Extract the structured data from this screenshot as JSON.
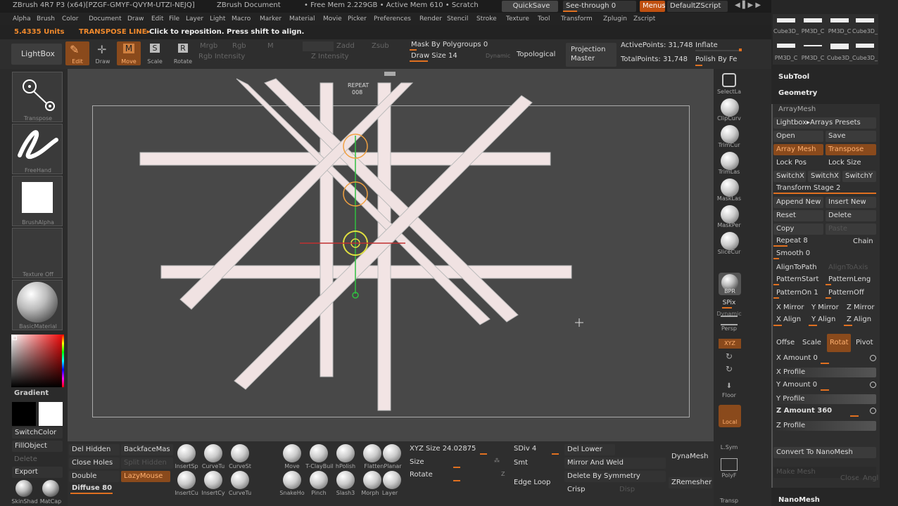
{
  "header": {
    "title": "ZBrush 4R7 P3 (x64)[PZGF-GMYF-QVYM-UTZI-NEJQ]",
    "doc": "ZBrush Document",
    "mem": "• Free Mem 2.229GB • Active Mem 610 • Scratch",
    "quicksave": "QuickSave",
    "seethrough": "See-through  0",
    "menus": "Menus",
    "script": "DefaultZScript"
  },
  "menu": [
    "Alpha",
    "Brush",
    "Color",
    "Document",
    "Draw",
    "Edit",
    "File",
    "Layer",
    "Light",
    "Macro",
    "Marker",
    "Material",
    "Movie",
    "Picker",
    "Preferences",
    "Render",
    "Stencil",
    "Stroke",
    "Texture",
    "Tool",
    "Transform",
    "Zplugin",
    "Zscript"
  ],
  "note": {
    "units": "5.4335 Units",
    "mode": "TRANSPOSE LINE▸",
    "msg": "Click to reposition. Press shift to align."
  },
  "shelf": {
    "lightbox": "LightBox",
    "edit": "Edit",
    "draw": "Draw",
    "move": "Move",
    "scale": "Scale",
    "rotate": "Rotate",
    "mrgb": "Mrgb",
    "rgb": "Rgb",
    "m": "M",
    "rgbint": "Rgb Intensity",
    "zadd": "Zadd",
    "zsub": "Zsub",
    "zint": "Z Intensity",
    "mask": "Mask By Polygroups 0",
    "drawsize": "Draw Size 14",
    "dynamic": "Dynamic",
    "topological": "Topological",
    "projection": "Projection",
    "master": "Master",
    "activepts": "ActivePoints: 31,748",
    "totalpts": "TotalPoints: 31,748",
    "inflate": "Inflate",
    "polishbyfe": "Polish By Fe"
  },
  "left": {
    "transpose": "Transpose",
    "freehand": "FreeHand",
    "brushalpha": "BrushAlpha",
    "texture": "Texture Off",
    "material": "BasicMaterial",
    "gradient": "Gradient",
    "switchcolor": "SwitchColor",
    "fillobject": "FillObject",
    "delete": "Delete",
    "export": "Export",
    "skinshade": "SkinShad",
    "matcap": "MatCap"
  },
  "canvas": {
    "repeat": "REPEAT",
    "repeatval": "008"
  },
  "rightshelf": {
    "selectla": "SelectLa",
    "clipcurv": "ClipCurv",
    "trimcur": "TrimCur",
    "trimlas": "TrimLas",
    "masklas": "MaskLas",
    "maskper": "MaskPer",
    "slicecur": "SliceCur",
    "bpr": "BPR",
    "spix": "SPix",
    "persp": "Persp",
    "xyz": "XYZ",
    "floor": "Floor",
    "local": "Local",
    "lsym": "L.Sym",
    "polyf": "PolyF",
    "transp": "Transp",
    "dynamic": "Dynamic"
  },
  "bottom": {
    "delhidden": "Del Hidden",
    "backface": "BackfaceMas",
    "closeholes": "Close Holes",
    "splithidden": "Split Hidden",
    "double": "Double",
    "lazymouse": "LazyMouse",
    "diffuse": "Diffuse 80",
    "brushes": [
      "InsertSp",
      "CurveTu",
      "CurveSt",
      "Move",
      "T-ClayBuil",
      "hPolish",
      "FlattenPlanar",
      "InsertCu",
      "InsertCy",
      "CurveTu",
      "SnakeHo",
      "Pinch",
      "Slash3",
      "Morph",
      "Layer"
    ],
    "xyzsize": "XYZ Size 24.02875",
    "size": "Size",
    "rotate": "Rotate",
    "sdiv": "SDiv 4",
    "smt": "Smt",
    "edgeloop": "Edge Loop",
    "dellower": "Del Lower",
    "mirrorweld": "Mirror And Weld",
    "delsym": "Delete By Symmetry",
    "crisp": "Crisp",
    "disp": "Disp",
    "dynamesh": "DynaMesh",
    "zremesher": "ZRemesher"
  },
  "tray": {
    "thumbs": [
      "Cube3D_",
      "PM3D_C",
      "PM3D_C",
      "Cube3D_",
      "PM3D_C",
      "PM3D_C",
      "Cube3D_",
      "Cube3D_"
    ],
    "subtool": "SubTool",
    "geometry": "Geometry",
    "arraymesh": "ArrayMesh",
    "lightboxarr": "Lightbox▸Arrays Presets",
    "open": "Open",
    "save": "Save",
    "arraymeshbtn": "Array Mesh",
    "transpose": "Transpose",
    "lockpos": "Lock Pos",
    "locksize": "Lock Size",
    "switchx": "SwitchX",
    "switchxy": "SwitchX",
    "switchy": "SwitchY",
    "stage": "Transform Stage 2",
    "append": "Append New",
    "insert": "Insert New",
    "reset": "Reset",
    "delete": "Delete",
    "copy": "Copy",
    "paste": "Paste",
    "repeat": "Repeat 8",
    "chain": "Chain",
    "smooth": "Smooth 0",
    "aligntopath": "AlignToPath",
    "aligntoaxis": "AlignToAxis",
    "patternstart": "PatternStart",
    "patternlength": "PatternLeng",
    "patternon": "PatternOn 1",
    "patternoff": "PatternOff",
    "xmirror": "X Mirror",
    "ymirror": "Y Mirror",
    "zmirror": "Z Mirror",
    "xalign": "X Align",
    "yalign": "Y Align",
    "zalign": "Z Align",
    "offset": "Offse",
    "scale": "Scale",
    "rotat": "Rotat",
    "pivot": "Pivot",
    "xamount": "X Amount 0",
    "xprofile": "X Profile",
    "yamount": "Y Amount 0",
    "yprofile": "Y Profile",
    "zamount": "Z Amount 360",
    "zprofile": "Z Profile",
    "convert": "Convert To NanoMesh",
    "makemesh": "Make Mesh",
    "close": "Close",
    "angle": "Angle",
    "nanomesh": "NanoMesh"
  }
}
